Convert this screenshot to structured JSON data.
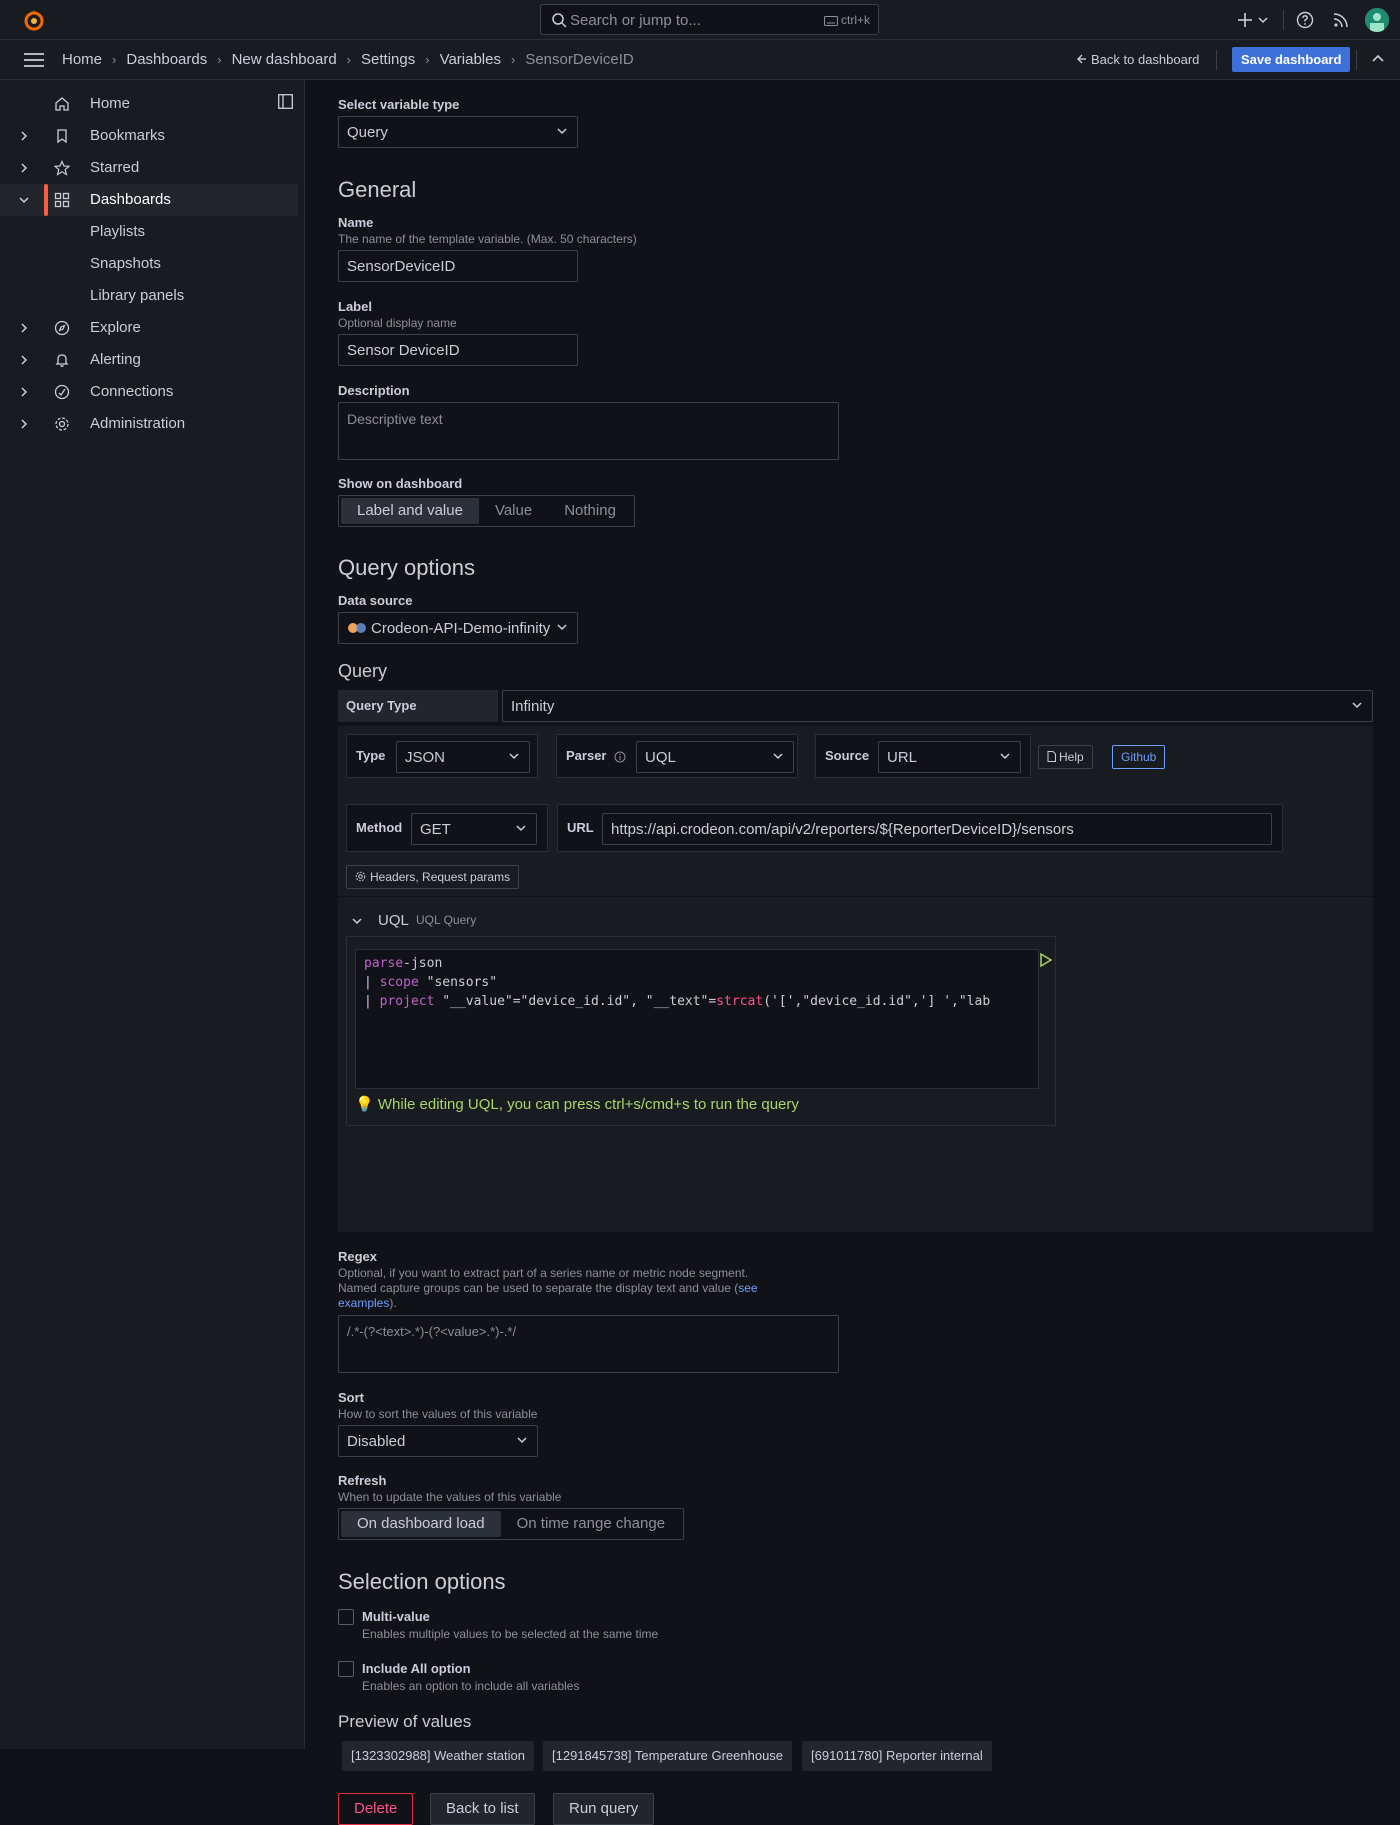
{
  "topbar": {
    "search_placeholder": "Search or jump to...",
    "search_shortcut": "ctrl+k"
  },
  "breadcrumbs": [
    "Home",
    "Dashboards",
    "New dashboard",
    "Settings",
    "Variables",
    "SensorDeviceID"
  ],
  "nav": {
    "back_to_dashboard": "Back to dashboard",
    "save_dashboard": "Save dashboard"
  },
  "sidebar": {
    "items": [
      {
        "label": "Home"
      },
      {
        "label": "Bookmarks"
      },
      {
        "label": "Starred"
      },
      {
        "label": "Dashboards"
      },
      {
        "label": "Explore"
      },
      {
        "label": "Alerting"
      },
      {
        "label": "Connections"
      },
      {
        "label": "Administration"
      }
    ],
    "subitems": [
      "Playlists",
      "Snapshots",
      "Library panels"
    ]
  },
  "form": {
    "variable_type_label": "Select variable type",
    "variable_type_value": "Query",
    "general_heading": "General",
    "name_label": "Name",
    "name_desc": "The name of the template variable. (Max. 50 characters)",
    "name_value": "SensorDeviceID",
    "label_label": "Label",
    "label_desc": "Optional display name",
    "label_value": "Sensor DeviceID",
    "description_label": "Description",
    "description_placeholder": "Descriptive text",
    "show_label": "Show on dashboard",
    "show_options": [
      "Label and value",
      "Value",
      "Nothing"
    ],
    "query_options_heading": "Query options",
    "datasource_label": "Data source",
    "datasource_value": "Crodeon-API-Demo-infinity",
    "query_heading": "Query",
    "query_type_label": "Query Type",
    "query_type_value": "Infinity",
    "type_label": "Type",
    "type_value": "JSON",
    "parser_label": "Parser",
    "parser_value": "UQL",
    "source_label": "Source",
    "source_value": "URL",
    "help_label": "Help",
    "github_label": "Github",
    "method_label": "Method",
    "method_value": "GET",
    "url_label": "URL",
    "url_value": "https://api.crodeon.com/api/v2/reporters/${ReporterDeviceID}/sensors",
    "headers_label": "Headers, Request params",
    "uql_label": "UQL",
    "uql_sub": "UQL Query",
    "uql_tip": "While editing UQL, you can press ctrl+s/cmd+s to run the query",
    "regex_label": "Regex",
    "regex_desc1": "Optional, if you want to extract part of a series name or metric node segment.",
    "regex_desc2": "Named capture groups can be used to separate the display text and value (",
    "regex_link1": "see",
    "regex_link2": "examples",
    "regex_desc3": ").",
    "regex_placeholder": "/.*-(?<text>.*)-(?<value>.*)-.*/",
    "sort_label": "Sort",
    "sort_desc": "How to sort the values of this variable",
    "sort_value": "Disabled",
    "refresh_label": "Refresh",
    "refresh_desc": "When to update the values of this variable",
    "refresh_options": [
      "On dashboard load",
      "On time range change"
    ],
    "selection_heading": "Selection options",
    "multi_label": "Multi-value",
    "multi_desc": "Enables multiple values to be selected at the same time",
    "all_label": "Include All option",
    "all_desc": "Enables an option to include all variables",
    "preview_heading": "Preview of values",
    "preview_values": [
      "[1323302988] Weather station",
      "[1291845738] Temperature Greenhouse",
      "[691011780] Reporter internal"
    ],
    "delete": "Delete",
    "back_to_list": "Back to list",
    "run_query": "Run query"
  },
  "code": {
    "l1a": "parse",
    "l1b": "-json",
    "l2a": "| ",
    "l2b": "scope",
    "l2c": " \"sensors\"",
    "l3a": "| ",
    "l3b": "project",
    "l3c": " \"__value\"=\"device_id.id\", \"__text\"=",
    "l3d": "strcat",
    "l3e": "('[',\"device_id.id\",'] ',\"lab"
  }
}
